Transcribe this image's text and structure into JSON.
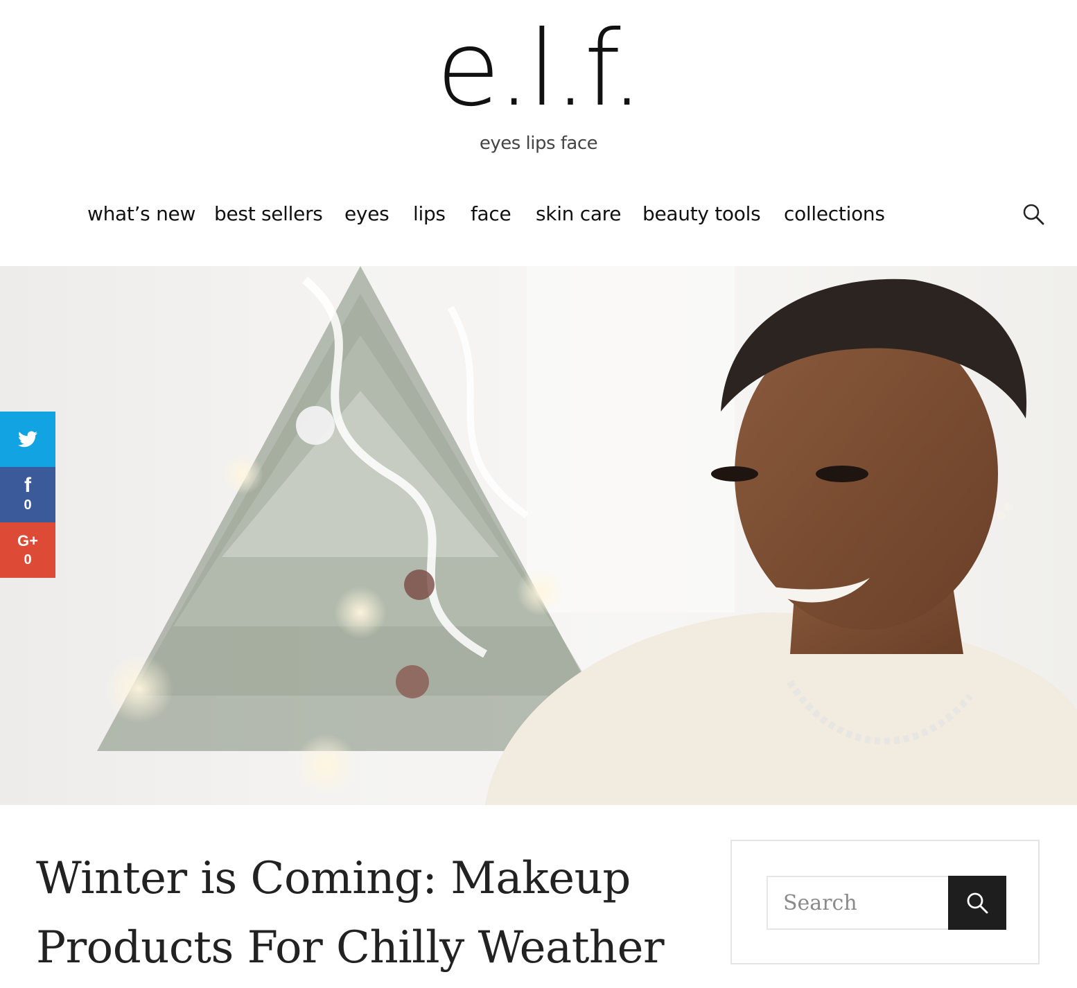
{
  "brand": {
    "logo_text": "e.l.f.",
    "tagline": "eyes lips face"
  },
  "nav": {
    "items": [
      {
        "label": "what’s new"
      },
      {
        "label": "best sellers"
      },
      {
        "label": "eyes"
      },
      {
        "label": "lips"
      },
      {
        "label": "face"
      },
      {
        "label": "skin care"
      },
      {
        "label": "beauty tools"
      },
      {
        "label": "collections"
      }
    ],
    "search_icon": "search-icon"
  },
  "hero": {
    "image_alt": "Woman in cream sweater smiling beside a snowy Christmas tree"
  },
  "social": {
    "twitter": {
      "icon": "twitter-icon",
      "color": "#11a3e2"
    },
    "facebook": {
      "icon": "facebook-icon",
      "glyph": "f",
      "count": "0",
      "color": "#3b5a9a"
    },
    "googleplus": {
      "icon": "google-plus-icon",
      "glyph": "G+",
      "count": "0",
      "color": "#dd4b37"
    }
  },
  "article": {
    "title_line1": "Winter is Coming: Makeup",
    "title_line2": "Products For Chilly Weather"
  },
  "sidebar": {
    "search": {
      "placeholder": "Search",
      "value": "",
      "button_icon": "search-icon"
    }
  }
}
